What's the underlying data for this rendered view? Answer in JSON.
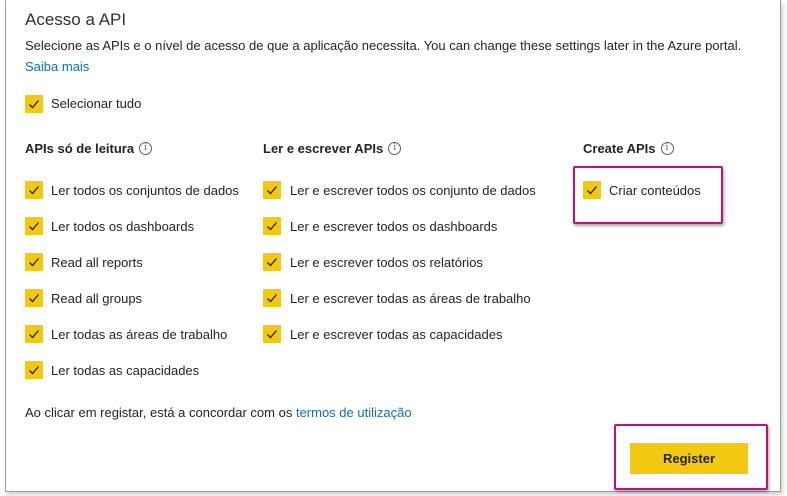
{
  "title": "Acesso a API",
  "description": "Selecione as APIs e o nível de acesso de que a aplicação necessita. You can change these settings later in the Azure portal.",
  "learn_more": "Saiba mais",
  "select_all": "Selecionar tudo",
  "columns": [
    {
      "header": "APIs só de leitura",
      "items": [
        "Ler todos os conjuntos de dados",
        "Ler todos os dashboards",
        "Read all reports",
        "Read all groups",
        "Ler todas as áreas de trabalho",
        "Ler todas as capacidades"
      ]
    },
    {
      "header": "Ler e escrever APIs",
      "items": [
        "Ler e escrever todos os conjunto de dados",
        "Ler e escrever todos os dashboards",
        "Ler e escrever todos os relatórios",
        "Ler e escrever todas as áreas de trabalho",
        "Ler e escrever todas as capacidades"
      ]
    },
    {
      "header": "Create APIs",
      "items": [
        "Criar conteúdos"
      ]
    }
  ],
  "info_glyph": "i",
  "agreement_prefix": "Ao clicar em registar, está a concordar com os ",
  "agreement_link": "termos de utilização",
  "register_button": "Register",
  "colors": {
    "checkbox": "#f2c811",
    "highlight": "#c2117f",
    "link": "#106ebe"
  }
}
